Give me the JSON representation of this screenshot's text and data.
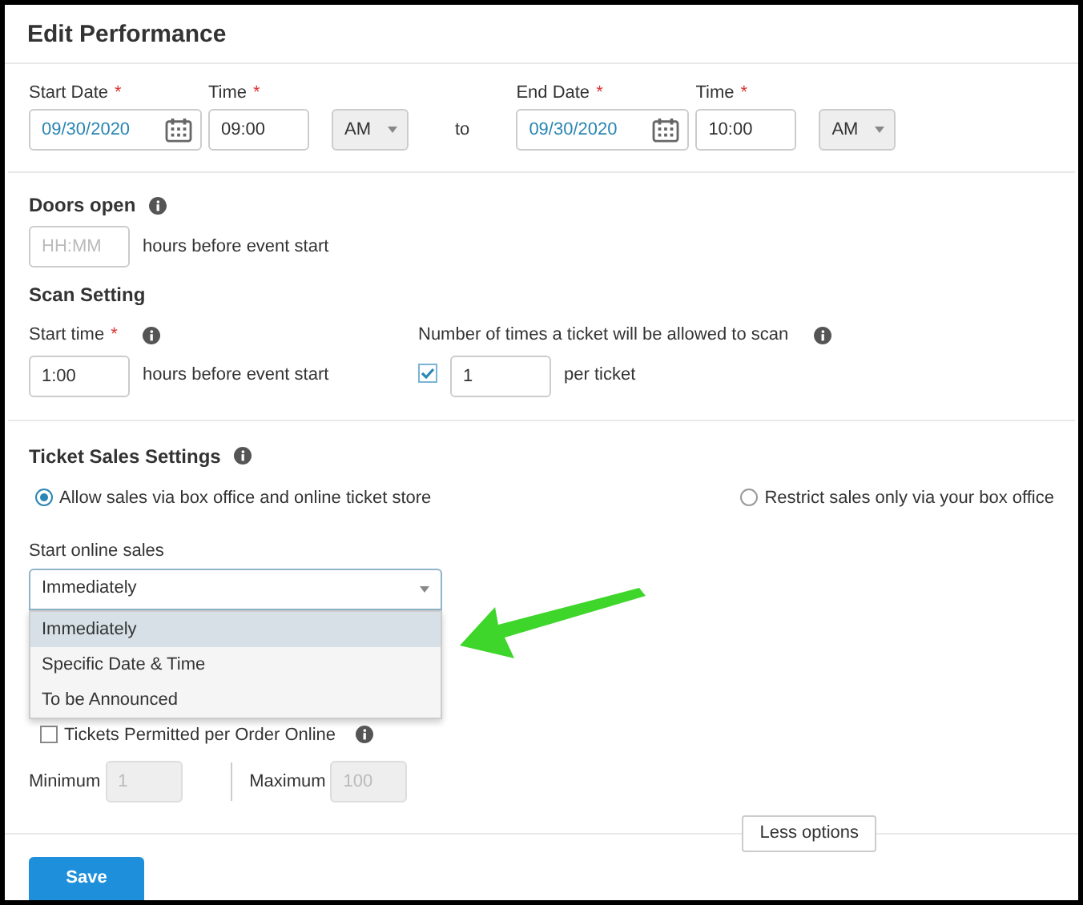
{
  "title": "Edit Performance",
  "date_range": {
    "start": {
      "date_label": {
        "text": "Start Date",
        "mark": "*"
      },
      "date": "09/30/2020",
      "time_label": {
        "text": "Time",
        "mark": "*"
      },
      "time": "09:00",
      "meridiem": "AM"
    },
    "separator": "to",
    "end": {
      "date_label": {
        "text": "End Date",
        "mark": "*"
      },
      "date": "09/30/2020",
      "time_label": {
        "text": "Time",
        "mark": "*"
      },
      "time": "10:00",
      "meridiem": "AM"
    }
  },
  "doors_open": {
    "label": "Doors open",
    "placeholder": "HH:MM",
    "suffix": "hours before event start"
  },
  "scan_setting": {
    "heading": "Scan Setting",
    "start_time": {
      "label": {
        "text": "Start time",
        "mark": "*"
      },
      "value": "1:00",
      "suffix": "hours before event start"
    },
    "scan_limit": {
      "label": "Number of times a ticket will be allowed to scan",
      "checked": true,
      "value": "1",
      "suffix": "per ticket"
    }
  },
  "ticket_sales": {
    "heading": "Ticket Sales Settings",
    "options": [
      {
        "label": "Allow sales via box office and online ticket store",
        "selected": true
      },
      {
        "label": "Restrict sales only via your box office",
        "selected": false
      }
    ],
    "start_online_sales": {
      "label": "Start online sales",
      "value": "Immediately",
      "expanded": true,
      "options": [
        {
          "label": "Immediately",
          "selected": true
        },
        {
          "label": "Specific Date & Time",
          "selected": false
        },
        {
          "label": "To be Announced",
          "selected": false
        }
      ]
    },
    "per_order": {
      "label": "Tickets Permitted per Order Online",
      "checked": false,
      "minimum": {
        "label": "Minimum",
        "placeholder": "1",
        "disabled": true
      },
      "maximum": {
        "label": "Maximum",
        "placeholder": "100",
        "disabled": true
      }
    }
  },
  "less_options": "Less options",
  "save": "Save"
}
